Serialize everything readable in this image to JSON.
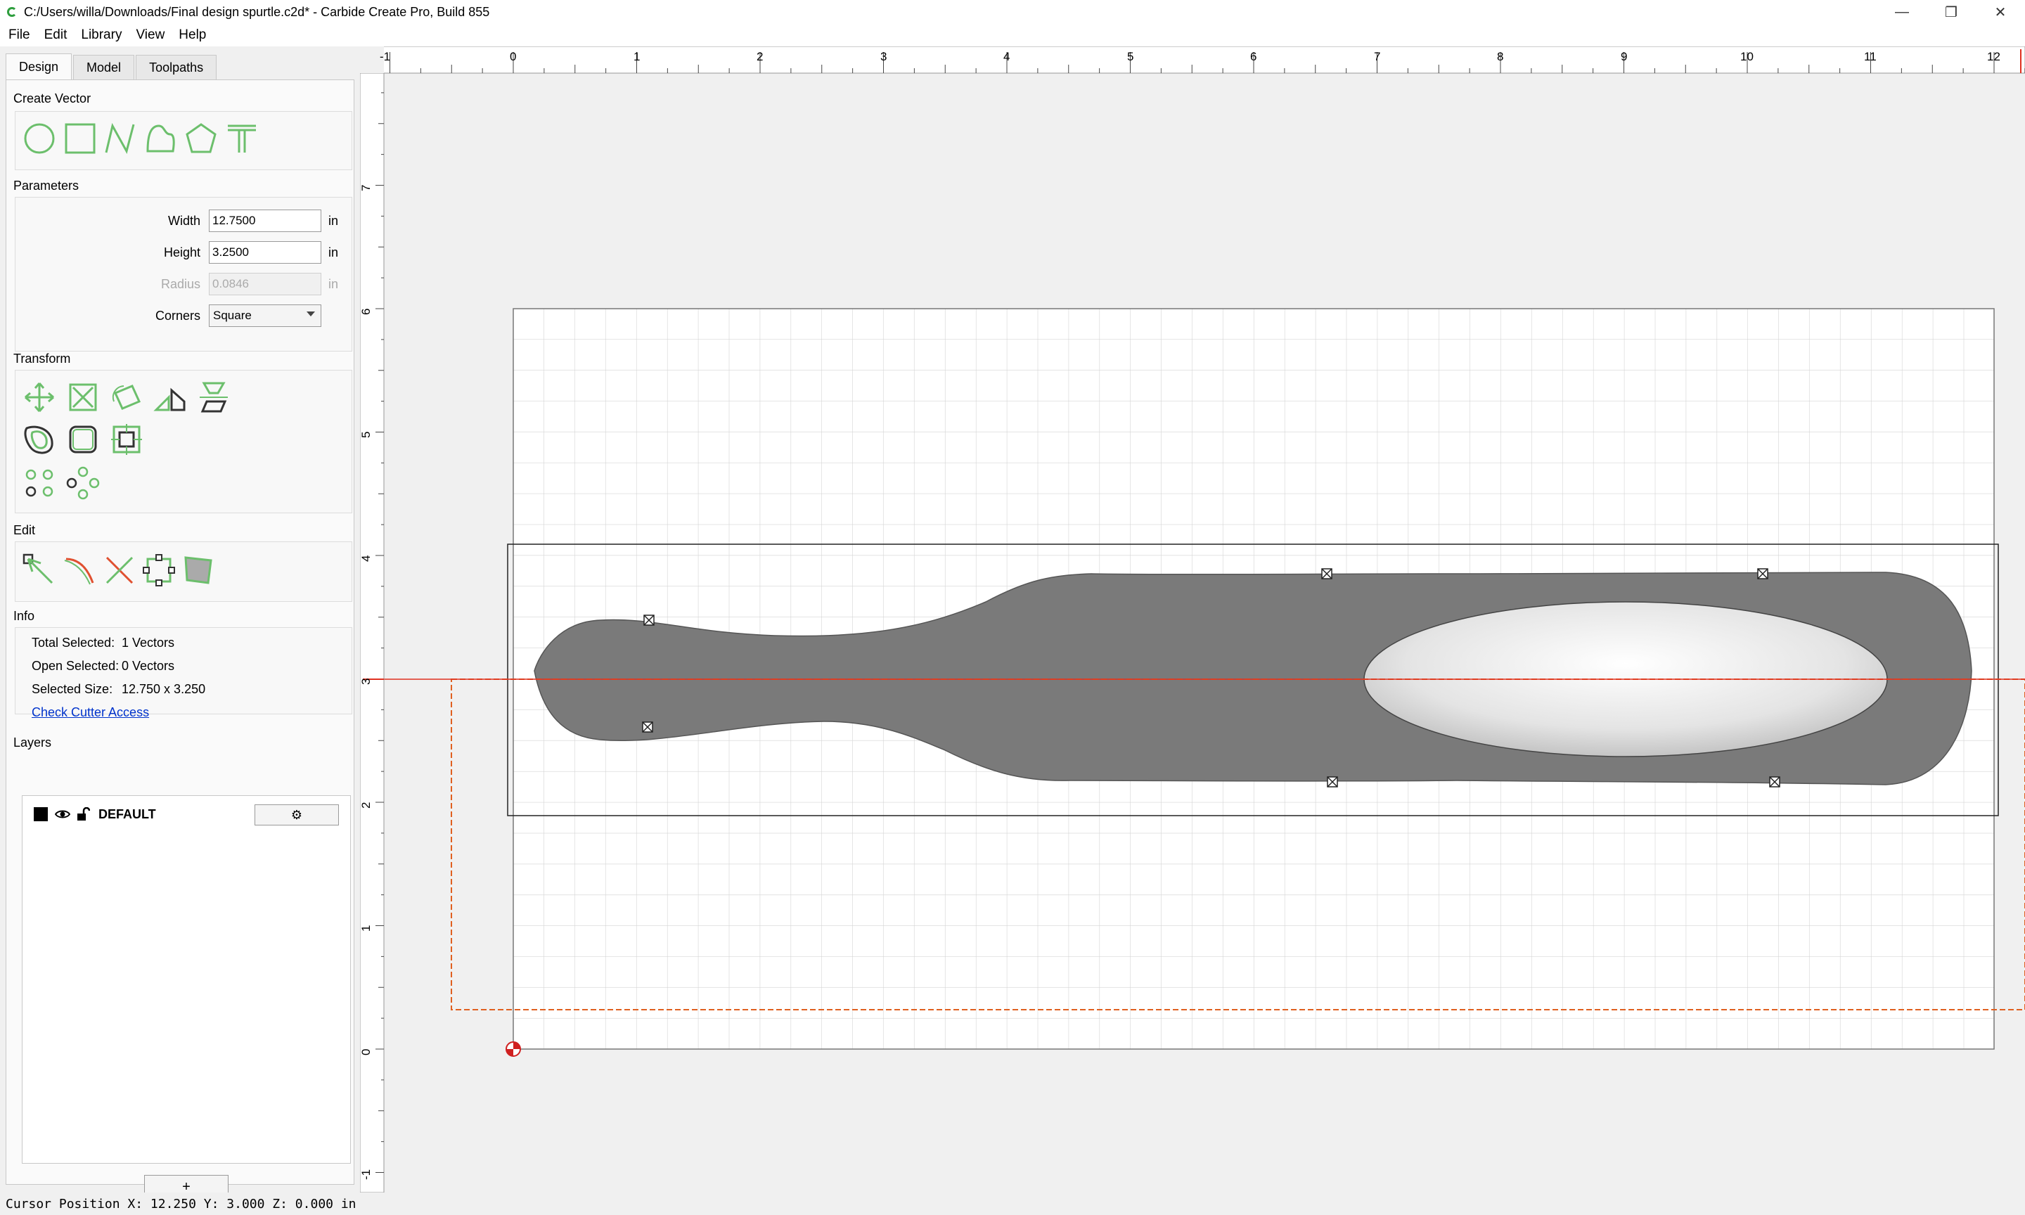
{
  "window": {
    "title": "C:/Users/willa/Downloads/Final design spurtle.c2d* - Carbide Create Pro, Build 855",
    "minimize": "—",
    "restore": "❐",
    "close": "✕"
  },
  "menu": [
    "File",
    "Edit",
    "Library",
    "View",
    "Help"
  ],
  "tabs": [
    "Design",
    "Model",
    "Toolpaths"
  ],
  "sections": {
    "create_vector": "Create Vector",
    "parameters": "Parameters",
    "transform": "Transform",
    "edit": "Edit",
    "info": "Info",
    "layers": "Layers"
  },
  "params": {
    "width_label": "Width",
    "width_value": "12.7500",
    "height_label": "Height",
    "height_value": "3.2500",
    "radius_label": "Radius",
    "radius_value": "0.0846",
    "unit": "in",
    "corners_label": "Corners",
    "corners_value": "Square"
  },
  "info": {
    "total_label": "Total Selected:",
    "total_value": "1 Vectors",
    "open_label": "Open Selected:",
    "open_value": "0 Vectors",
    "size_label": "Selected Size:",
    "size_value": "12.750 x 3.250",
    "check_link": "Check Cutter Access"
  },
  "layers": {
    "name": "DEFAULT",
    "gear": "⚙",
    "add": "+",
    "swatch_color": "#000000"
  },
  "status": "Cursor Position X: 12.250 Y: 3.000 Z: 0.000 in",
  "ruler": {
    "x_labels": [
      "-1",
      "0",
      "1",
      "2",
      "3",
      "4",
      "5",
      "6",
      "7",
      "8",
      "9",
      "10",
      "11",
      "12"
    ],
    "y_labels": [
      "7",
      "6",
      "5",
      "4",
      "3",
      "2",
      "1",
      "0",
      "-1"
    ]
  },
  "colors": {
    "accent_green": "#6cbf6c",
    "shape_fill": "#7a7a7a",
    "cursor_line": "#e03020",
    "stock_outline": "#e06020"
  }
}
